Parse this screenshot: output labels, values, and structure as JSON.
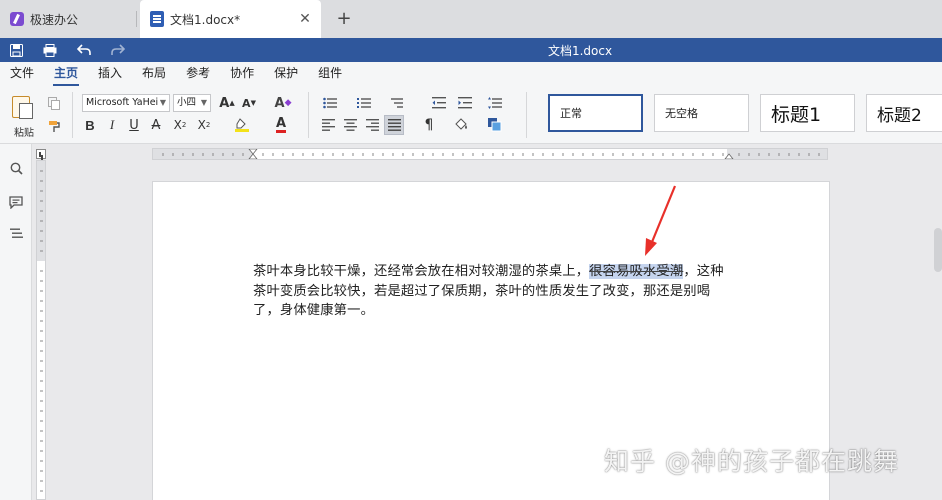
{
  "tabs": [
    {
      "label": "极速办公",
      "active": false
    },
    {
      "label": "文档1.docx*",
      "active": true
    }
  ],
  "window": {
    "title": "文档1.docx"
  },
  "menu": {
    "items": [
      "文件",
      "主页",
      "插入",
      "布局",
      "参考",
      "协作",
      "保护",
      "组件"
    ],
    "active": "主页"
  },
  "ribbon": {
    "paste_label": "粘贴",
    "font_name": "Microsoft YaHei",
    "font_size": "小四",
    "styles": [
      {
        "label": "正常",
        "selected": true
      },
      {
        "label": "无空格",
        "selected": false
      },
      {
        "label": "标题1",
        "selected": false
      },
      {
        "label": "标题2",
        "selected": false
      }
    ]
  },
  "document": {
    "text_before": "茶叶本身比较干燥，还经常会放在相对较潮湿的茶桌上，",
    "text_highlight": "很容易吸水受潮",
    "text_after": "，这种茶叶变质会比较快，若是超过了保质期，茶叶的性质发生了改变，那还是别喝了，身体健康第一。"
  },
  "watermark": "知乎 @神的孩子都在跳舞",
  "colors": {
    "titlebar": "#2f579c",
    "accent": "#2f579c",
    "highlight": "#c5d4ee",
    "annotation_arrow": "#e8302a"
  }
}
